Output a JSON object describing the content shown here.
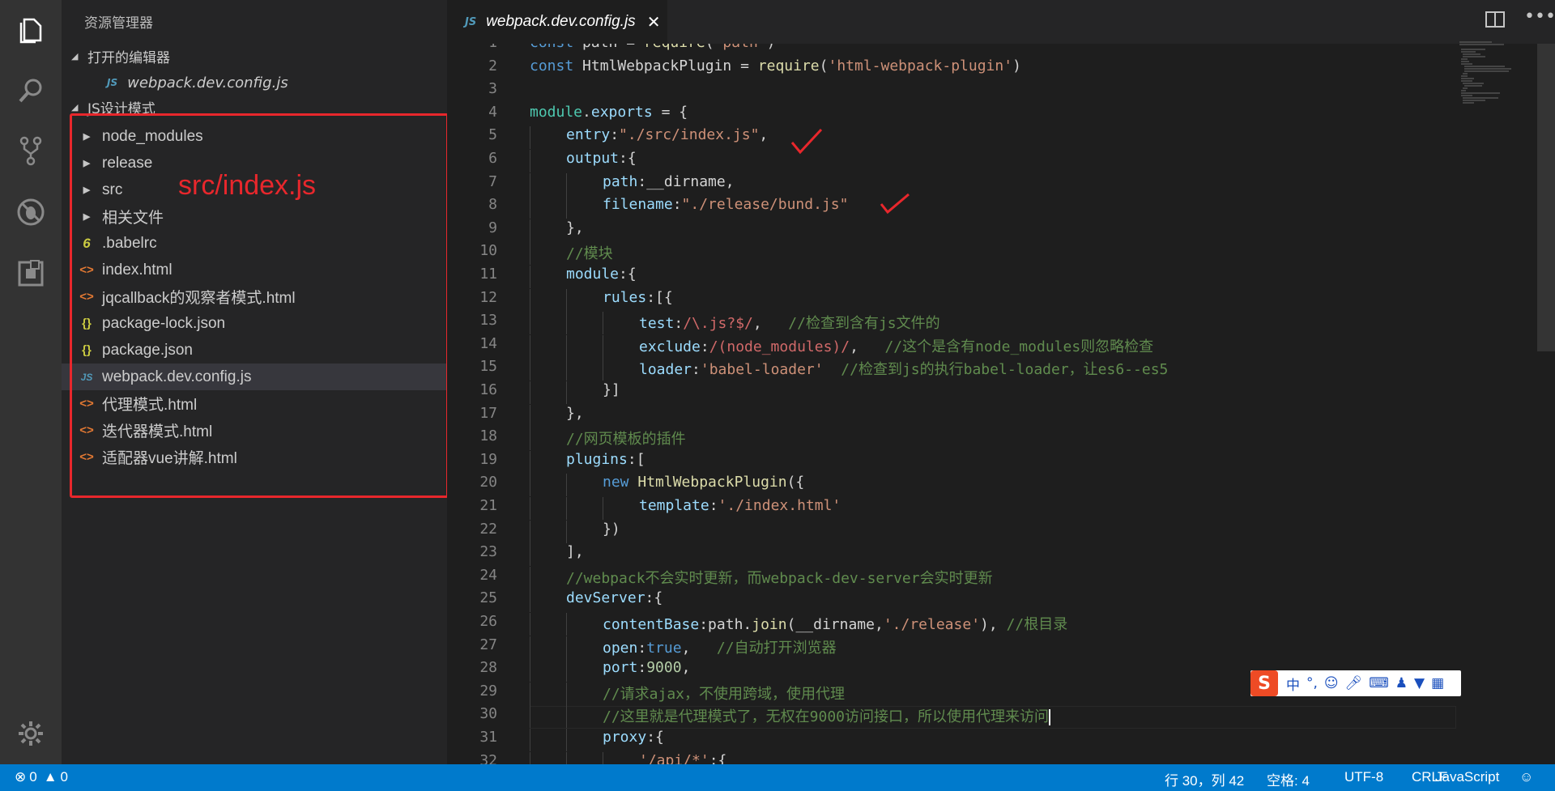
{
  "sidebar": {
    "title": "资源管理器",
    "open_editors": {
      "label": "打开的编辑器",
      "file": "webpack.dev.config.js",
      "badge": "JS"
    },
    "project": {
      "label": "JS设计模式"
    },
    "items": [
      {
        "label": "node_modules",
        "icon": "chevron-right-icon"
      },
      {
        "label": "release",
        "icon": "chevron-right-icon"
      },
      {
        "label": "src",
        "icon": "chevron-right-icon"
      },
      {
        "label": "相关文件",
        "icon": "chevron-right-icon"
      },
      {
        "label": ".babelrc",
        "icon": "babel-icon"
      },
      {
        "label": "index.html",
        "icon": "html-icon"
      },
      {
        "label": "jqcallback的观察者模式.html",
        "icon": "html-icon"
      },
      {
        "label": "package-lock.json",
        "icon": "json-icon"
      },
      {
        "label": "package.json",
        "icon": "json-icon"
      },
      {
        "label": "webpack.dev.config.js",
        "icon": "js-file-icon",
        "selected": true
      },
      {
        "label": "代理模式.html",
        "icon": "html-icon"
      },
      {
        "label": "迭代器模式.html",
        "icon": "html-icon"
      },
      {
        "label": "适配器vue讲解.html",
        "icon": "html-icon"
      }
    ],
    "glyphs": {
      "folder": "▶",
      "babel": "6",
      "html": "<>",
      "json": "{}",
      "js": "JS"
    },
    "annotation": "src/index.js"
  },
  "tab": {
    "label": "webpack.dev.config.js",
    "badge": "JS",
    "close": "✕"
  },
  "code_lines": [
    {
      "n": "1",
      "indent": 0,
      "tokens": [
        [
          "kw",
          "const "
        ],
        [
          "plain",
          "path = "
        ],
        [
          "fn",
          "require"
        ],
        [
          "plain",
          "("
        ],
        [
          "str",
          "'path'"
        ],
        [
          "plain",
          ")"
        ]
      ]
    },
    {
      "n": "2",
      "indent": 0,
      "tokens": [
        [
          "kw",
          "const "
        ],
        [
          "plain",
          "HtmlWebpackPlugin = "
        ],
        [
          "fn",
          "require"
        ],
        [
          "plain",
          "("
        ],
        [
          "str",
          "'html-webpack-plugin'"
        ],
        [
          "plain",
          ")"
        ]
      ]
    },
    {
      "n": "3",
      "indent": 0,
      "tokens": []
    },
    {
      "n": "4",
      "indent": 0,
      "tokens": [
        [
          "cls",
          "module"
        ],
        [
          "plain",
          "."
        ],
        [
          "prop",
          "exports"
        ],
        [
          "plain",
          " = {"
        ]
      ]
    },
    {
      "n": "5",
      "indent": 1,
      "tokens": [
        [
          "prop",
          "entry"
        ],
        [
          "plain",
          ":"
        ],
        [
          "str",
          "\"./src/index.js\""
        ],
        [
          "plain",
          ","
        ]
      ]
    },
    {
      "n": "6",
      "indent": 1,
      "tokens": [
        [
          "prop",
          "output"
        ],
        [
          "plain",
          ":{"
        ]
      ]
    },
    {
      "n": "7",
      "indent": 2,
      "tokens": [
        [
          "prop",
          "path"
        ],
        [
          "plain",
          ":__dirname,"
        ]
      ]
    },
    {
      "n": "8",
      "indent": 2,
      "tokens": [
        [
          "prop",
          "filename"
        ],
        [
          "plain",
          ":"
        ],
        [
          "str",
          "\"./release/bund.js\""
        ]
      ]
    },
    {
      "n": "9",
      "indent": 1,
      "tokens": [
        [
          "plain",
          "},"
        ]
      ]
    },
    {
      "n": "10",
      "indent": 1,
      "tokens": [
        [
          "cmt",
          "//模块"
        ]
      ]
    },
    {
      "n": "11",
      "indent": 1,
      "tokens": [
        [
          "prop",
          "module"
        ],
        [
          "plain",
          ":{"
        ]
      ]
    },
    {
      "n": "12",
      "indent": 2,
      "tokens": [
        [
          "prop",
          "rules"
        ],
        [
          "plain",
          ":[{"
        ]
      ]
    },
    {
      "n": "13",
      "indent": 3,
      "tokens": [
        [
          "prop",
          "test"
        ],
        [
          "plain",
          ":"
        ],
        [
          "re",
          "/\\.js?$/"
        ],
        [
          "plain",
          ",   "
        ],
        [
          "cmt",
          "//检查到含有js文件的"
        ]
      ]
    },
    {
      "n": "14",
      "indent": 3,
      "tokens": [
        [
          "prop",
          "exclude"
        ],
        [
          "plain",
          ":"
        ],
        [
          "re",
          "/(node_modules)/"
        ],
        [
          "plain",
          ",   "
        ],
        [
          "cmt",
          "//这个是含有node_modules则忽略检查"
        ]
      ]
    },
    {
      "n": "15",
      "indent": 3,
      "tokens": [
        [
          "prop",
          "loader"
        ],
        [
          "plain",
          ":"
        ],
        [
          "str",
          "'babel-loader'"
        ],
        [
          "plain",
          "  "
        ],
        [
          "cmt",
          "//检查到js的执行babel-loader，让es6--es5"
        ]
      ]
    },
    {
      "n": "16",
      "indent": 2,
      "tokens": [
        [
          "plain",
          "}]"
        ]
      ]
    },
    {
      "n": "17",
      "indent": 1,
      "tokens": [
        [
          "plain",
          "},"
        ]
      ]
    },
    {
      "n": "18",
      "indent": 1,
      "tokens": [
        [
          "cmt",
          "//网页模板的插件"
        ]
      ]
    },
    {
      "n": "19",
      "indent": 1,
      "tokens": [
        [
          "prop",
          "plugins"
        ],
        [
          "plain",
          ":["
        ]
      ]
    },
    {
      "n": "20",
      "indent": 2,
      "tokens": [
        [
          "kw",
          "new "
        ],
        [
          "fn",
          "HtmlWebpackPlugin"
        ],
        [
          "plain",
          "({"
        ]
      ]
    },
    {
      "n": "21",
      "indent": 3,
      "tokens": [
        [
          "prop",
          "template"
        ],
        [
          "plain",
          ":"
        ],
        [
          "str",
          "'./index.html'"
        ]
      ]
    },
    {
      "n": "22",
      "indent": 2,
      "tokens": [
        [
          "plain",
          "})"
        ]
      ]
    },
    {
      "n": "23",
      "indent": 1,
      "tokens": [
        [
          "plain",
          "],"
        ]
      ]
    },
    {
      "n": "24",
      "indent": 1,
      "tokens": [
        [
          "cmt",
          "//webpack不会实时更新，而webpack-dev-server会实时更新"
        ]
      ]
    },
    {
      "n": "25",
      "indent": 1,
      "tokens": [
        [
          "prop",
          "devServer"
        ],
        [
          "plain",
          ":{"
        ]
      ]
    },
    {
      "n": "26",
      "indent": 2,
      "tokens": [
        [
          "prop",
          "contentBase"
        ],
        [
          "plain",
          ":path."
        ],
        [
          "fn",
          "join"
        ],
        [
          "plain",
          "(__dirname,"
        ],
        [
          "str",
          "'./release'"
        ],
        [
          "plain",
          "), "
        ],
        [
          "cmt",
          "//根目录"
        ]
      ]
    },
    {
      "n": "27",
      "indent": 2,
      "tokens": [
        [
          "prop",
          "open"
        ],
        [
          "plain",
          ":"
        ],
        [
          "kw",
          "true"
        ],
        [
          "plain",
          ",   "
        ],
        [
          "cmt",
          "//自动打开浏览器"
        ]
      ]
    },
    {
      "n": "28",
      "indent": 2,
      "tokens": [
        [
          "prop",
          "port"
        ],
        [
          "plain",
          ":"
        ],
        [
          "num",
          "9000"
        ],
        [
          "plain",
          ","
        ]
      ]
    },
    {
      "n": "29",
      "indent": 2,
      "tokens": [
        [
          "cmt",
          "//请求ajax，不使用跨域，使用代理"
        ]
      ]
    },
    {
      "n": "30",
      "indent": 2,
      "tokens": [
        [
          "cmt",
          "//这里就是代理模式了，无权在9000访问接口，所以使用代理来访问"
        ]
      ],
      "cursor": true
    },
    {
      "n": "31",
      "indent": 2,
      "tokens": [
        [
          "prop",
          "proxy"
        ],
        [
          "plain",
          ":{"
        ]
      ]
    },
    {
      "n": "32",
      "indent": 3,
      "tokens": [
        [
          "str",
          "'/api/*'"
        ],
        [
          "plain",
          ":{"
        ]
      ]
    }
  ],
  "ime": {
    "logo": "S",
    "mode": "中",
    "punct": "°,"
  },
  "statusbar": {
    "errors": "0",
    "warnings": "0",
    "position": "行 30，列 42",
    "indent": "空格: 4",
    "encoding": "UTF-8",
    "eol": "CRLF",
    "language": "JavaScript"
  },
  "colors": {
    "accent": "#007acc",
    "annotation": "#e8272c"
  }
}
